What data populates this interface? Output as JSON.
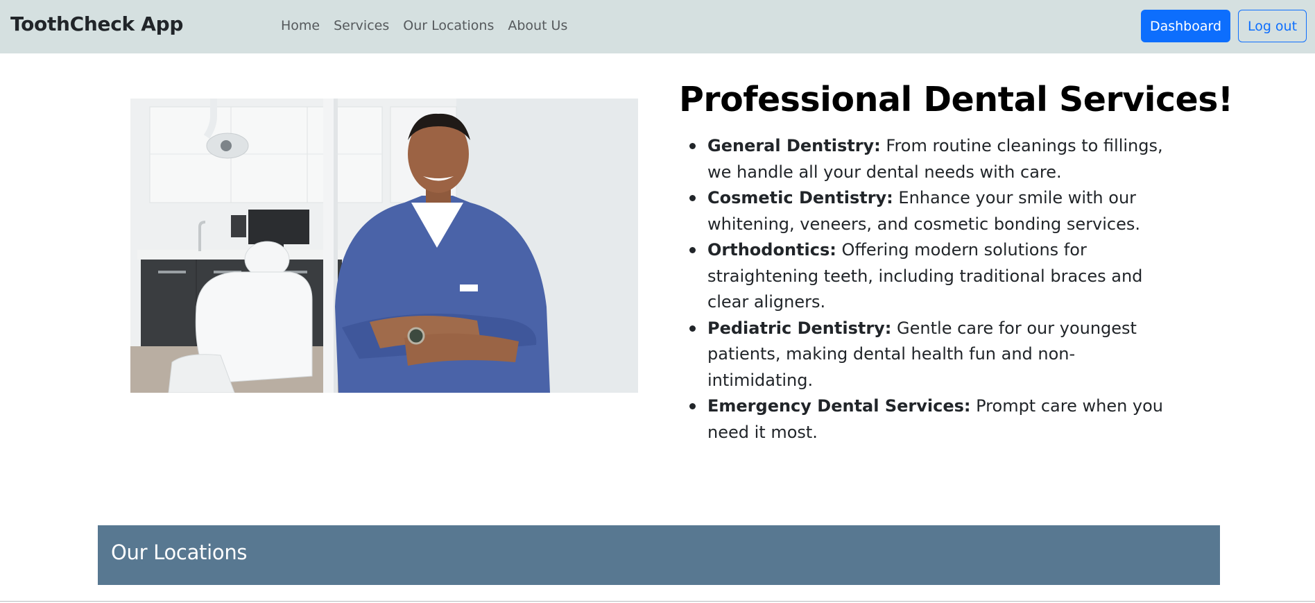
{
  "navbar": {
    "brand": "ToothCheck App",
    "links": [
      "Home",
      "Services",
      "Our Locations",
      "About Us"
    ],
    "dashboard_label": "Dashboard",
    "logout_label": "Log out"
  },
  "hero": {
    "title": "Professional Dental Services!",
    "services": [
      {
        "name": "General Dentistry:",
        "desc": " From routine cleanings to fillings, we handle all your dental needs with care."
      },
      {
        "name": "Cosmetic Dentistry:",
        "desc": " Enhance your smile with our whitening, veneers, and cosmetic bonding services."
      },
      {
        "name": "Orthodontics:",
        "desc": " Offering modern solutions for straightening teeth, including traditional braces and clear aligners."
      },
      {
        "name": "Pediatric Dentistry:",
        "desc": " Gentle care for our youngest patients, making dental health fun and non-intimidating."
      },
      {
        "name": "Emergency Dental Services:",
        "desc": " Prompt care when you need it most."
      }
    ]
  },
  "locations": {
    "title": "Our Locations"
  },
  "colors": {
    "navbar_bg": "#d5e0e0",
    "primary": "#0d6efd",
    "locations_bg": "#587891"
  }
}
